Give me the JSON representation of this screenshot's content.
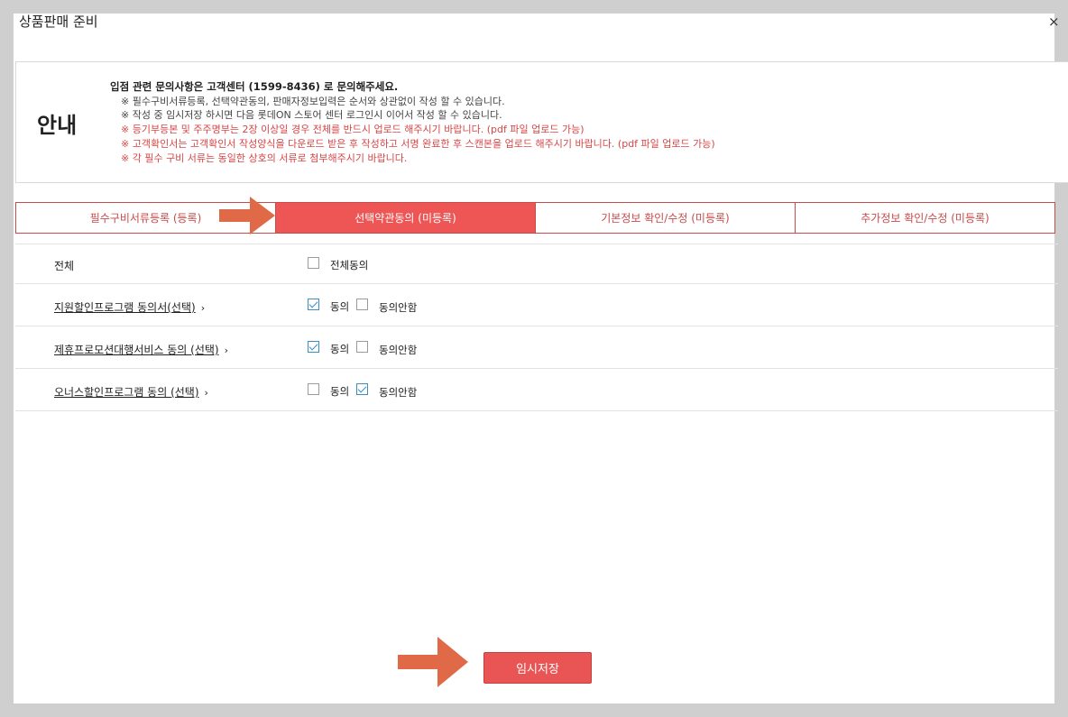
{
  "modal": {
    "title": "상품판매 준비",
    "close_symbol": "×"
  },
  "notice": {
    "heading": "안내",
    "lines": [
      "입점 관련 문의사항은 고객센터 (1599-8436) 로 문의해주세요.",
      "※ 필수구비서류등록, 선택약관동의, 판매자정보입력은 순서와 상관없이 작성 할 수 있습니다.",
      "※ 작성 중 임시저장 하시면 다음 롯데ON 스토어 센터 로그인시 이어서 작성 할 수 있습니다.",
      "※ 등기부등본 및 주주명부는 2장 이상일 경우 전체를 반드시 업로드 해주시기 바랍니다. (pdf 파일 업로드 가능)",
      "※ 고객확인서는 고객확인서 작성양식을 다운로드 받은 후 작성하고 서명 완료한 후 스캔본을 업로드 해주시기 바랍니다. (pdf 파일 업로드 가능)",
      "※ 각 필수 구비 서류는 동일한 상호의 서류로 첨부해주시기 바랍니다."
    ]
  },
  "tabs": [
    {
      "label": "필수구비서류등록 (등록)"
    },
    {
      "label": "선택약관동의 (미등록)"
    },
    {
      "label": "기본정보 확인/수정 (미등록)"
    },
    {
      "label": "추가정보 확인/수정 (미등록)"
    }
  ],
  "active_tab_index": 1,
  "agreements": {
    "all": {
      "label": "전체",
      "checkbox_label": "전체동의",
      "checked": false
    },
    "items": [
      {
        "label": "지원할인프로그램 동의서(선택)",
        "chevron": "›",
        "agree_label": "동의",
        "disagree_label": "동의안함",
        "agree": true,
        "disagree": false
      },
      {
        "label": "제휴프로모션대행서비스 동의 (선택)",
        "chevron": "›",
        "agree_label": "동의",
        "disagree_label": "동의안함",
        "agree": true,
        "disagree": false
      },
      {
        "label": "오너스할인프로그램 동의 (선택)",
        "chevron": "›",
        "agree_label": "동의",
        "disagree_label": "동의안함",
        "agree": false,
        "disagree": true
      }
    ]
  },
  "footer": {
    "save_label": "임시저장"
  },
  "colors": {
    "accent": "#ee5555",
    "tab_border": "#c94a4a",
    "checkbox_checked": "#3b8ec2",
    "notice_red": "#d64545",
    "arrow": "#e06a48"
  },
  "icons": [
    "close-icon",
    "chevron-right-icon",
    "arrow-right-icon"
  ]
}
